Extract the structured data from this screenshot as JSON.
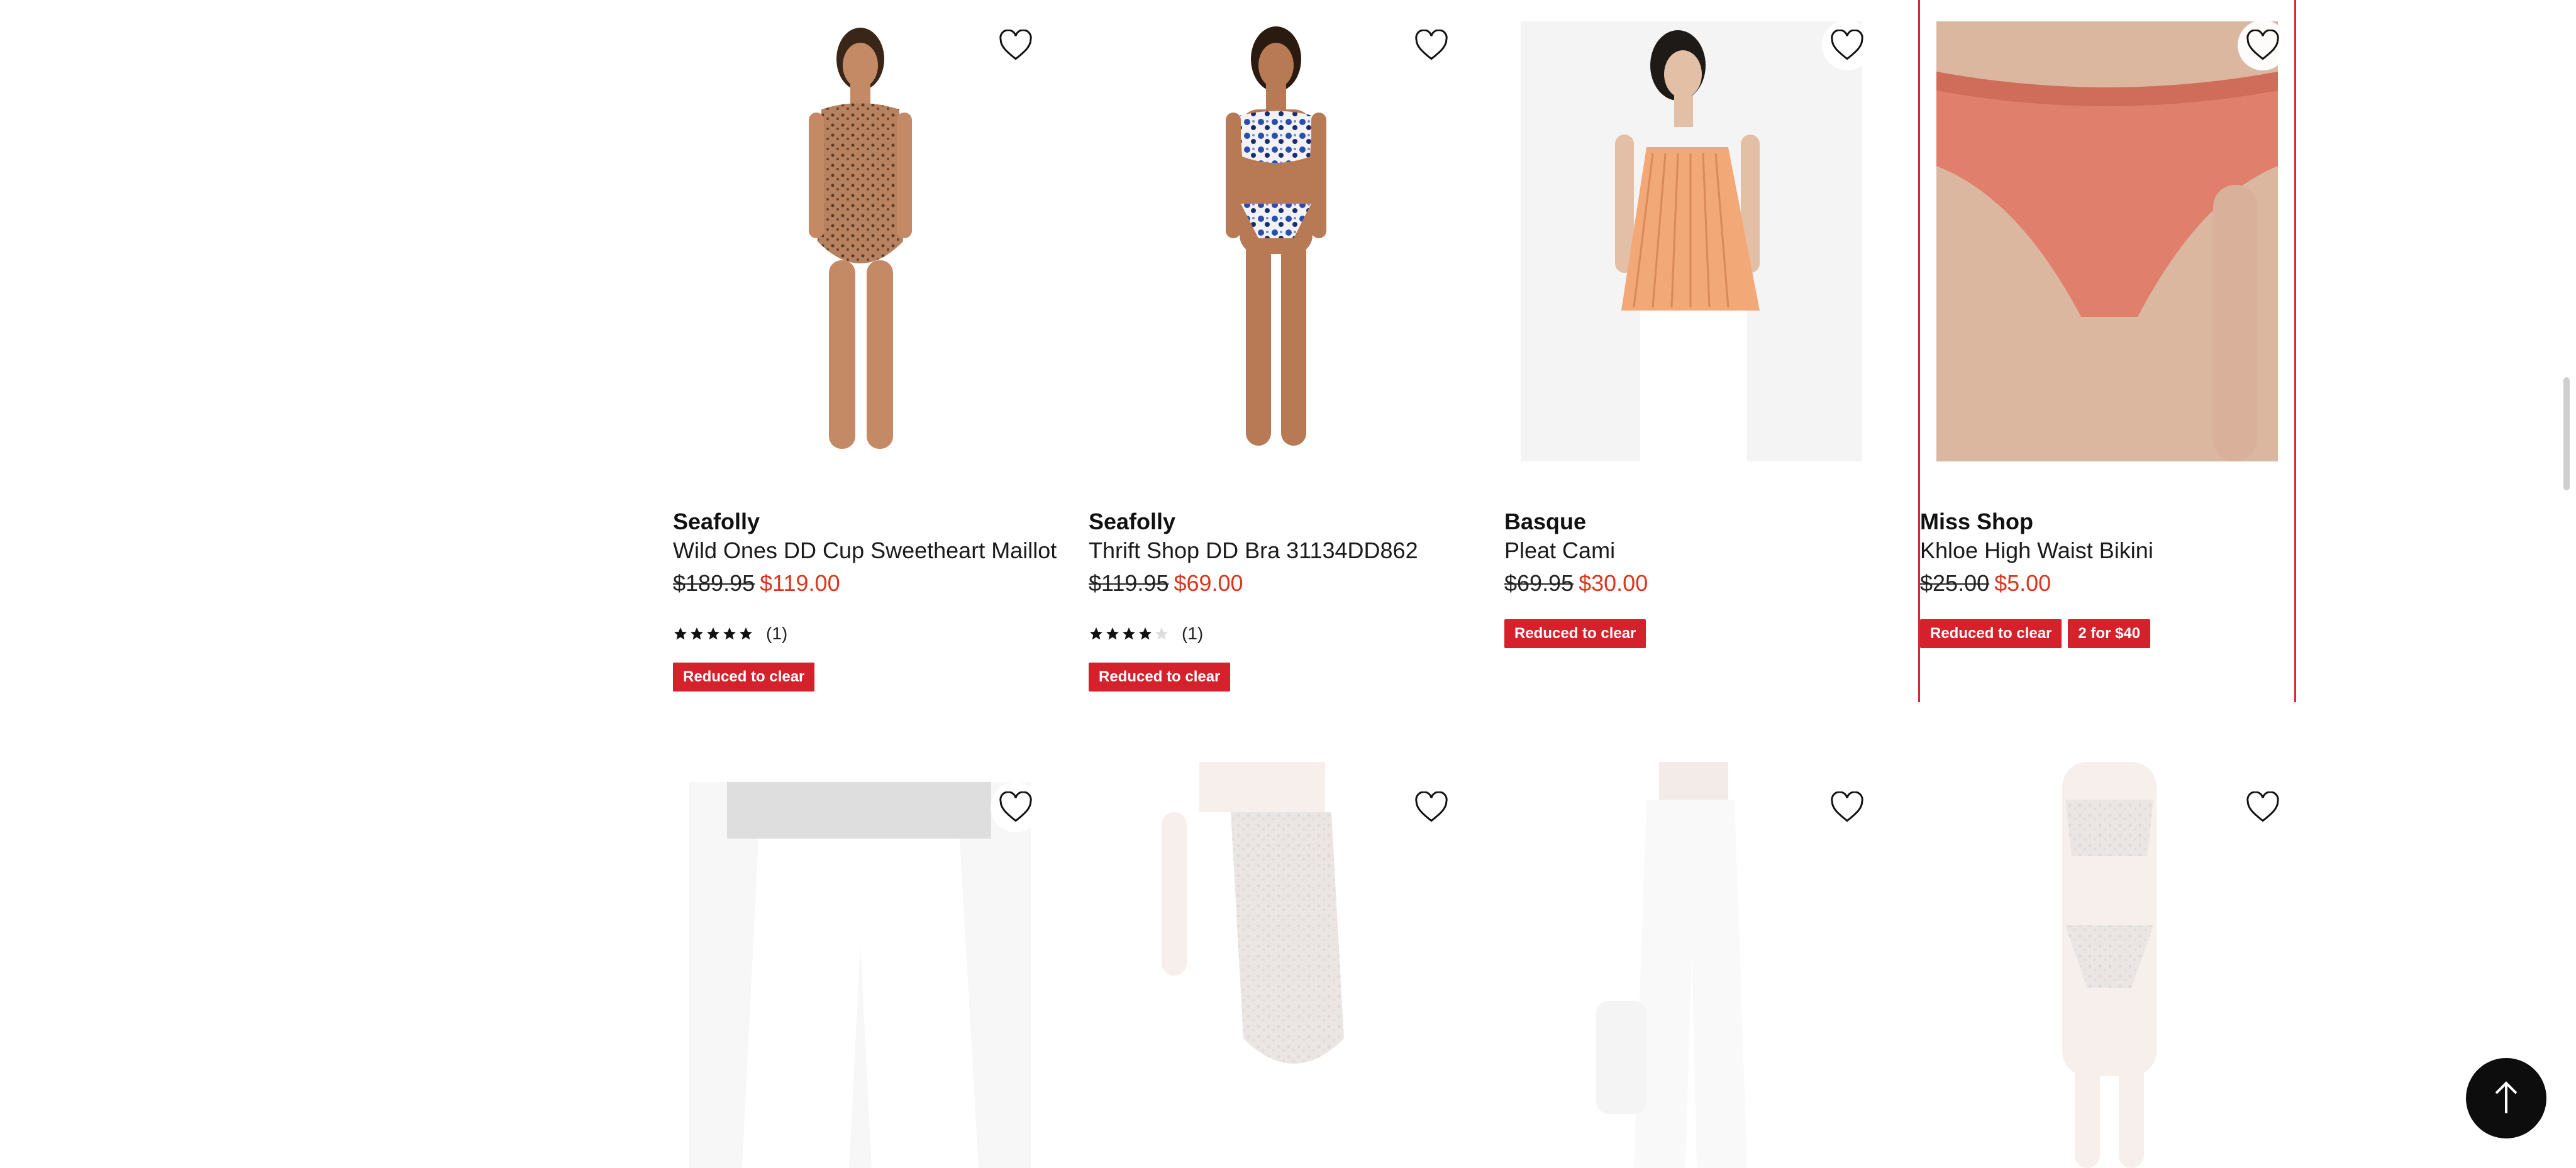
{
  "products_top": [
    {
      "brand": "Seafolly",
      "name": "Wild Ones DD Cup Sweetheart Maillot",
      "original_price": "$189.95",
      "sale_price": "$119.00",
      "rating_stars": 5,
      "review_count": "(1)",
      "badges": [
        "Reduced to clear"
      ],
      "image": "model-leopard-one-piece-swimsuit"
    },
    {
      "brand": "Seafolly",
      "name": "Thrift Shop DD Bra 31134DD862",
      "original_price": "$119.95",
      "sale_price": "$69.00",
      "rating_stars": 4,
      "review_count": "(1)",
      "badges": [
        "Reduced to clear"
      ],
      "image": "model-blue-floral-bikini"
    },
    {
      "brand": "Basque",
      "name": "Pleat Cami",
      "original_price": "$69.95",
      "sale_price": "$30.00",
      "badges": [
        "Reduced to clear"
      ],
      "image": "model-peach-pleated-cami"
    },
    {
      "brand": "Miss Shop",
      "name": "Khloe High Waist Bikini",
      "original_price": "$25.00",
      "sale_price": "$5.00",
      "badges": [
        "Reduced to clear",
        "2 for $40"
      ],
      "image": "model-coral-high-waist-brief"
    }
  ],
  "products_bottom": [
    {
      "image": "model-white-wide-leg-pants"
    },
    {
      "image": "model-leopard-strapless-bodysuit"
    },
    {
      "image": "model-white-strapless-jumpsuit"
    },
    {
      "image": "model-leopard-bikini-set"
    }
  ],
  "icons": {
    "favorite": "heart-outline-icon",
    "back_to_top": "arrow-up-icon",
    "rating": "star-icon"
  },
  "colors": {
    "sale_price": "#d9361f",
    "badge": "#d5212c",
    "highlight_border": "#e0262b",
    "back_to_top_bg": "#0d0d0d"
  }
}
